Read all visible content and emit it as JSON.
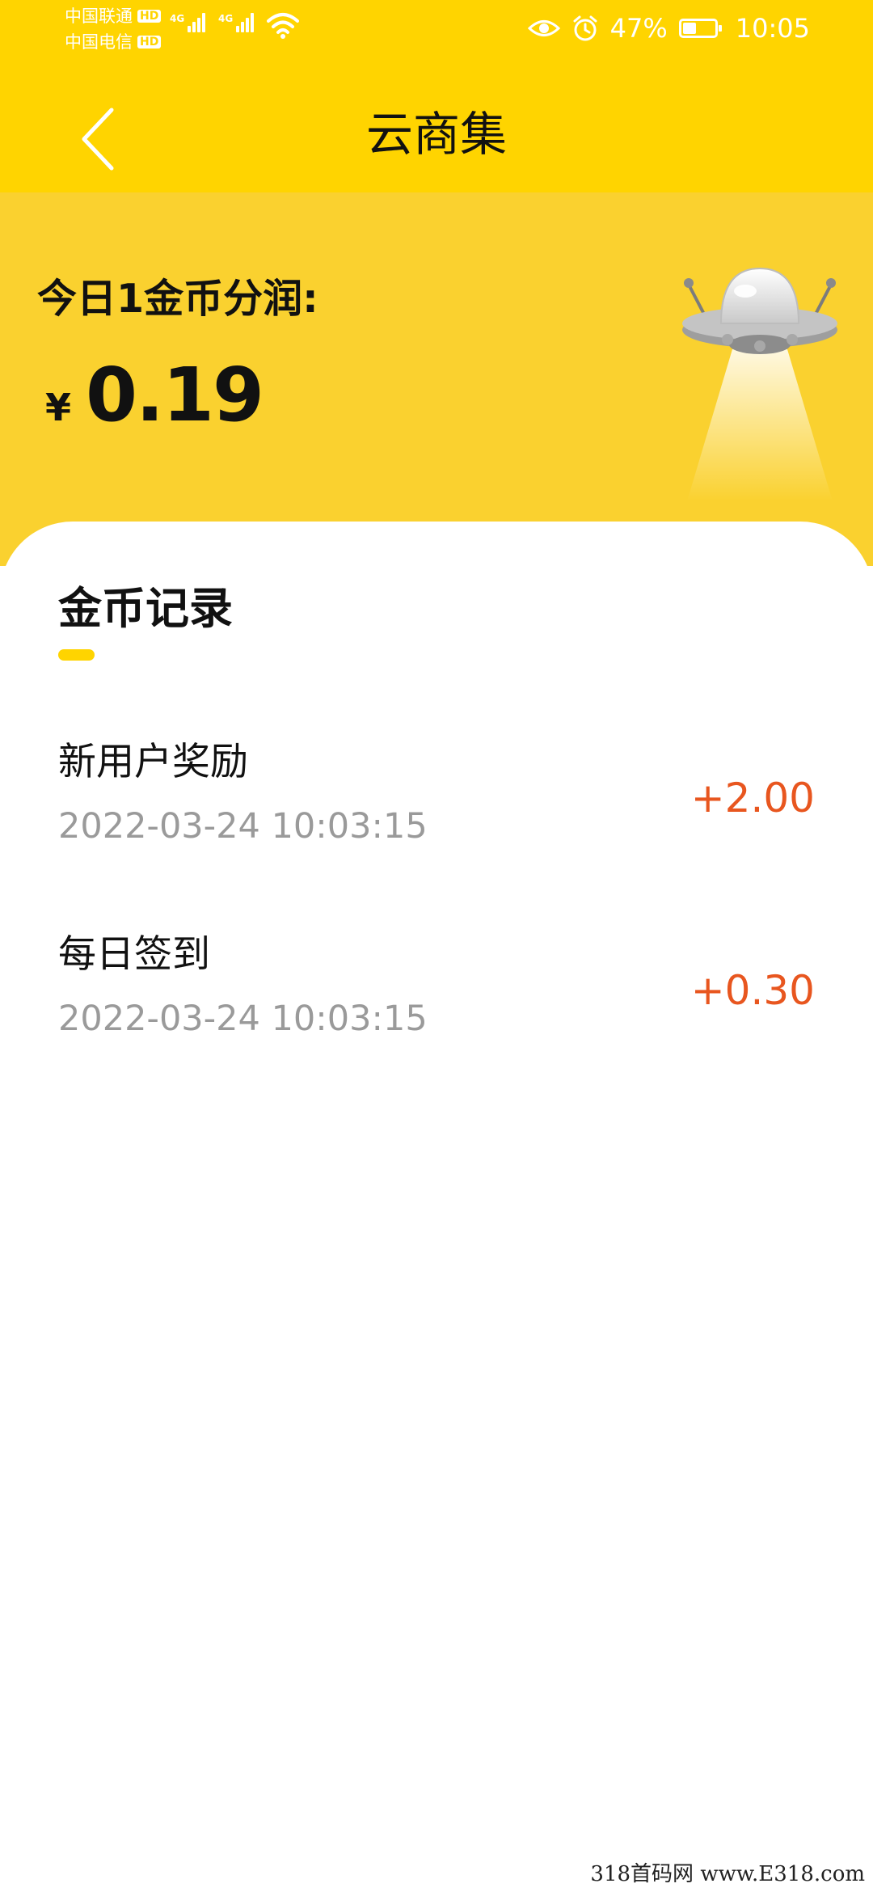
{
  "status_bar": {
    "carrier_1": "中国联通",
    "carrier_2": "中国电信",
    "hd_label": "HD",
    "network_type": "4G",
    "battery_percent": "47%",
    "battery_level": 0.47,
    "time": "10:05",
    "icons": [
      "signal-icon",
      "wifi-icon",
      "eye-icon",
      "alarm-icon",
      "battery-icon"
    ]
  },
  "header": {
    "title": "云商集",
    "back_icon": "chevron-left-icon"
  },
  "earnings": {
    "label": "今日1金币分润:",
    "currency": "¥",
    "value": "0.19"
  },
  "records": {
    "title": "金币记录",
    "items": [
      {
        "title": "新用户奖励",
        "time": "2022-03-24 10:03:15",
        "amount": "+2.00"
      },
      {
        "title": "每日签到",
        "time": "2022-03-24 10:03:15",
        "amount": "+0.30"
      }
    ]
  },
  "watermark": "318首码网 www.E318.com",
  "colors": {
    "header_yellow": "#FFD400",
    "banner_yellow": "#FAD12F",
    "accent_underline": "#FFD400",
    "amount_orange": "#E8561F",
    "time_gray": "#9A9A9A"
  }
}
